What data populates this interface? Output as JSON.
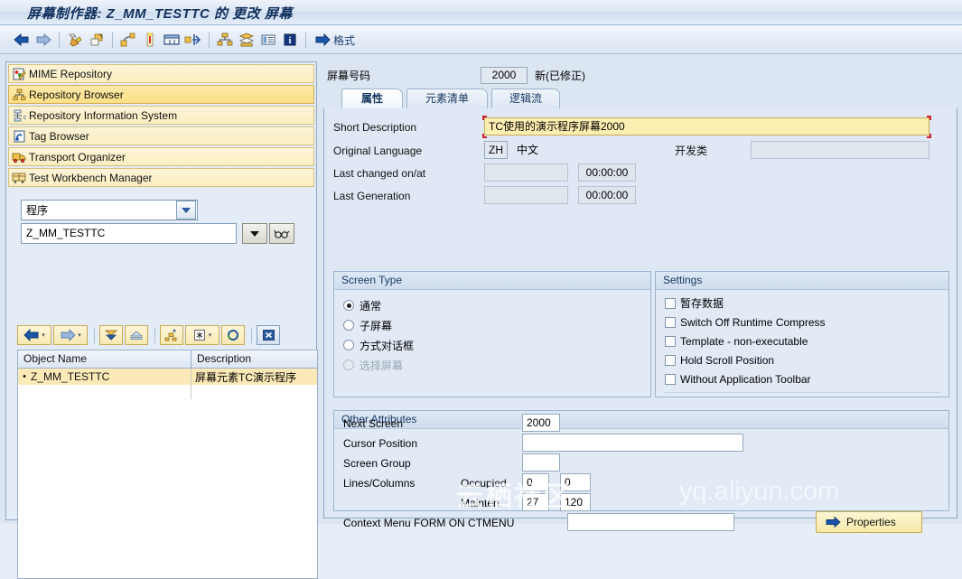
{
  "window": {
    "title": "屏幕制作器: Z_MM_TESTTC 的 更改 屏幕"
  },
  "toolbar": {
    "buttons": [
      {
        "name": "back-icon",
        "title": "返回"
      },
      {
        "name": "forward-icon",
        "title": "前进"
      },
      {
        "name": "pencil-edit-icon",
        "title": "编辑"
      },
      {
        "name": "copy-object-icon",
        "title": "复制"
      },
      {
        "name": "layout-editor-icon",
        "title": "布局"
      },
      {
        "name": "flow-logic-icon",
        "title": "流逻辑"
      },
      {
        "name": "screen-element-icon",
        "title": "屏幕元素"
      },
      {
        "name": "navigate-icon",
        "title": "导航"
      },
      {
        "name": "hierarchy-icon",
        "title": "层次"
      },
      {
        "name": "stack-icon",
        "title": "堆栈"
      },
      {
        "name": "list-icon",
        "title": "清单"
      },
      {
        "name": "information-icon",
        "title": "信息"
      }
    ],
    "format_label": "格式"
  },
  "sidebar": {
    "nav_items": [
      {
        "label": "MIME Repository",
        "icon": "mime-repository-icon",
        "selected": false
      },
      {
        "label": "Repository Browser",
        "icon": "repository-browser-icon",
        "selected": true
      },
      {
        "label": "Repository Information System",
        "icon": "repository-info-system-icon",
        "selected": false
      },
      {
        "label": "Tag Browser",
        "icon": "tag-browser-icon",
        "selected": false
      },
      {
        "label": "Transport Organizer",
        "icon": "transport-organizer-icon",
        "selected": false
      },
      {
        "label": "Test Workbench Manager",
        "icon": "test-workbench-icon",
        "selected": false
      }
    ],
    "object_type": "程序",
    "object_name": "Z_MM_TESTTC",
    "object_name_placeholder": "",
    "toolbar_buttons": [
      {
        "name": "nav-back-button",
        "icon": "arrow-left-icon"
      },
      {
        "name": "nav-forward-button",
        "icon": "arrow-right-icon"
      },
      {
        "name": "expand-all-button",
        "icon": "expand-down-icon"
      },
      {
        "name": "collapse-all-button",
        "icon": "collapse-up-icon"
      },
      {
        "name": "object-list-button",
        "icon": "hierarchy-icon"
      },
      {
        "name": "filter-button",
        "icon": "asterisk-icon"
      },
      {
        "name": "refresh-button",
        "icon": "refresh-icon"
      },
      {
        "name": "cancel-button",
        "icon": "close-x-icon"
      }
    ],
    "list": {
      "columns": [
        "Object Name",
        "Description"
      ],
      "rows": [
        {
          "name": "Z_MM_TESTTC",
          "description": "屏幕元素TC演示程序"
        }
      ]
    }
  },
  "main": {
    "screen_number_label": "屏幕号码",
    "screen_number_value": "2000",
    "screen_number_note": "新(已修正)",
    "tabs": [
      {
        "label": "属性",
        "active": true
      },
      {
        "label": "元素清单",
        "active": false
      },
      {
        "label": "逻辑流",
        "active": false
      }
    ],
    "attributes": {
      "short_description_label": "Short Description",
      "short_description_value": "TC使用的演示程序屏幕2000",
      "original_language_label": "Original Language",
      "original_language_code": "ZH",
      "original_language_name": "中文",
      "package_label": "开发类",
      "package_value": "",
      "last_changed_label": "Last changed on/at",
      "last_changed_date": "",
      "last_changed_time": "00:00:00",
      "last_generation_label": "Last Generation",
      "last_generation_date": "",
      "last_generation_time": "00:00:00"
    },
    "screen_type": {
      "title": "Screen Type",
      "options": [
        {
          "label": "通常",
          "selected": true,
          "disabled": false
        },
        {
          "label": "子屏幕",
          "selected": false,
          "disabled": false
        },
        {
          "label": "方式对话框",
          "selected": false,
          "disabled": false
        },
        {
          "label": "选择屏幕",
          "selected": false,
          "disabled": true
        }
      ]
    },
    "settings": {
      "title": "Settings",
      "options": [
        {
          "label": "暂存数据",
          "checked": false
        },
        {
          "label": "Switch Off Runtime Compress",
          "checked": false
        },
        {
          "label": "Template - non-executable",
          "checked": false
        },
        {
          "label": "Hold Scroll Position",
          "checked": false
        },
        {
          "label": "Without Application Toolbar",
          "checked": false
        }
      ]
    },
    "other_attributes": {
      "title": "Other Attributes",
      "next_screen_label": "Next Screen",
      "next_screen_value": "2000",
      "cursor_position_label": "Cursor Position",
      "cursor_position_value": "",
      "screen_group_label": "Screen Group",
      "screen_group_value": "",
      "lines_columns_label": "Lines/Columns",
      "occupied_label": "Occupied",
      "occupied_lines": "0",
      "occupied_columns": "0",
      "mainten_label": "Mainten.",
      "mainten_lines": "27",
      "mainten_columns": "120",
      "context_menu_label": "Context Menu FORM ON CTMENU",
      "context_menu_value": "",
      "properties_button": "Properties"
    }
  },
  "watermark": {
    "text_cn": "云栖社区",
    "text_url": "yq.aliyun.com"
  }
}
